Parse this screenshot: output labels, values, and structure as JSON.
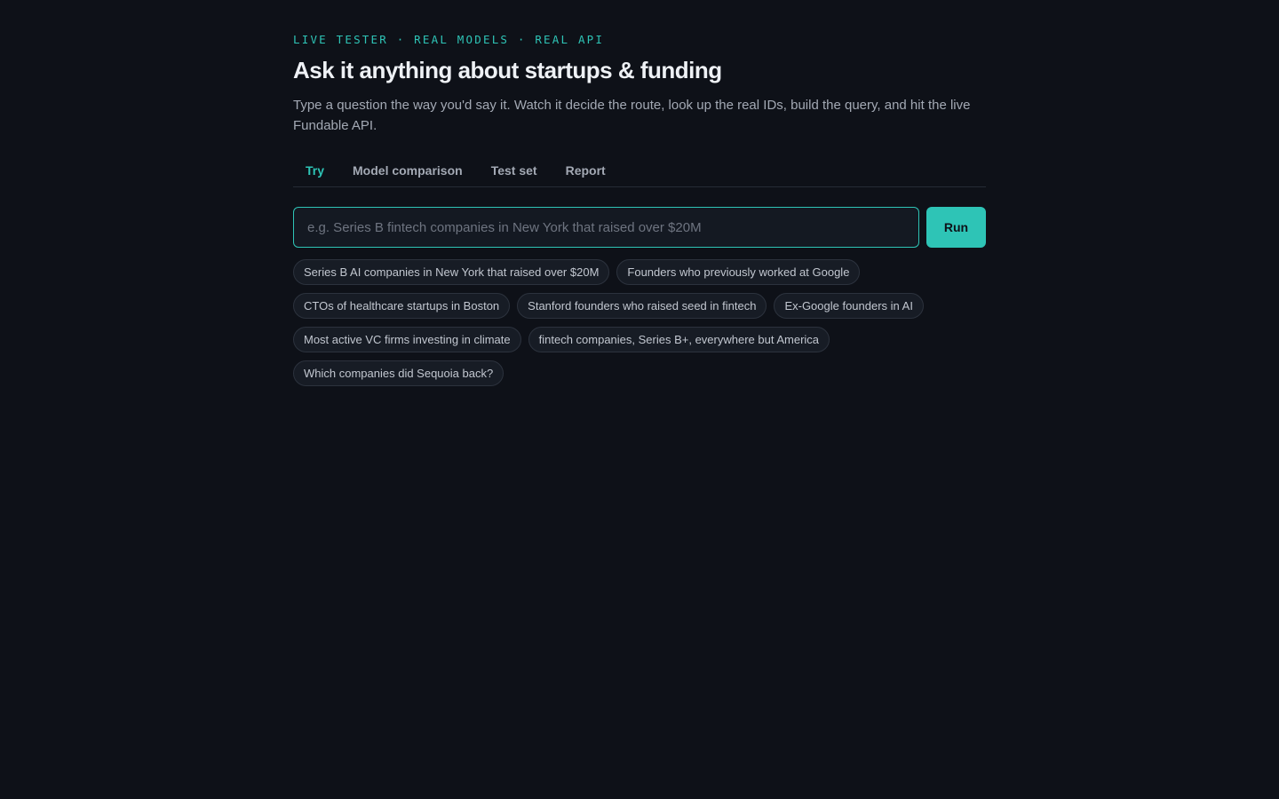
{
  "header": {
    "eyebrow": "LIVE TESTER · REAL MODELS · REAL API",
    "title": "Ask it anything about startups & funding",
    "subtitle": "Type a question the way you'd say it. Watch it decide the route, look up the real IDs, build the query, and hit the live Fundable API."
  },
  "tabs": [
    {
      "label": "Try",
      "active": true
    },
    {
      "label": "Model comparison",
      "active": false
    },
    {
      "label": "Test set",
      "active": false
    },
    {
      "label": "Report",
      "active": false
    }
  ],
  "query": {
    "value": "",
    "placeholder": "e.g. Series B fintech companies in New York that raised over $20M",
    "run_label": "Run"
  },
  "suggestions": [
    "Series B AI companies in New York that raised over $20M",
    "Founders who previously worked at Google",
    "CTOs of healthcare startups in Boston",
    "Stanford founders who raised seed in fintech",
    "Ex-Google founders in AI",
    "Most active VC firms investing in climate",
    "fintech companies, Series B+, everywhere but America",
    "Which companies did Sequoia back?"
  ],
  "colors": {
    "background": "#0e1118",
    "accent": "#2ec4b6",
    "text_muted": "#a3a9b4"
  }
}
